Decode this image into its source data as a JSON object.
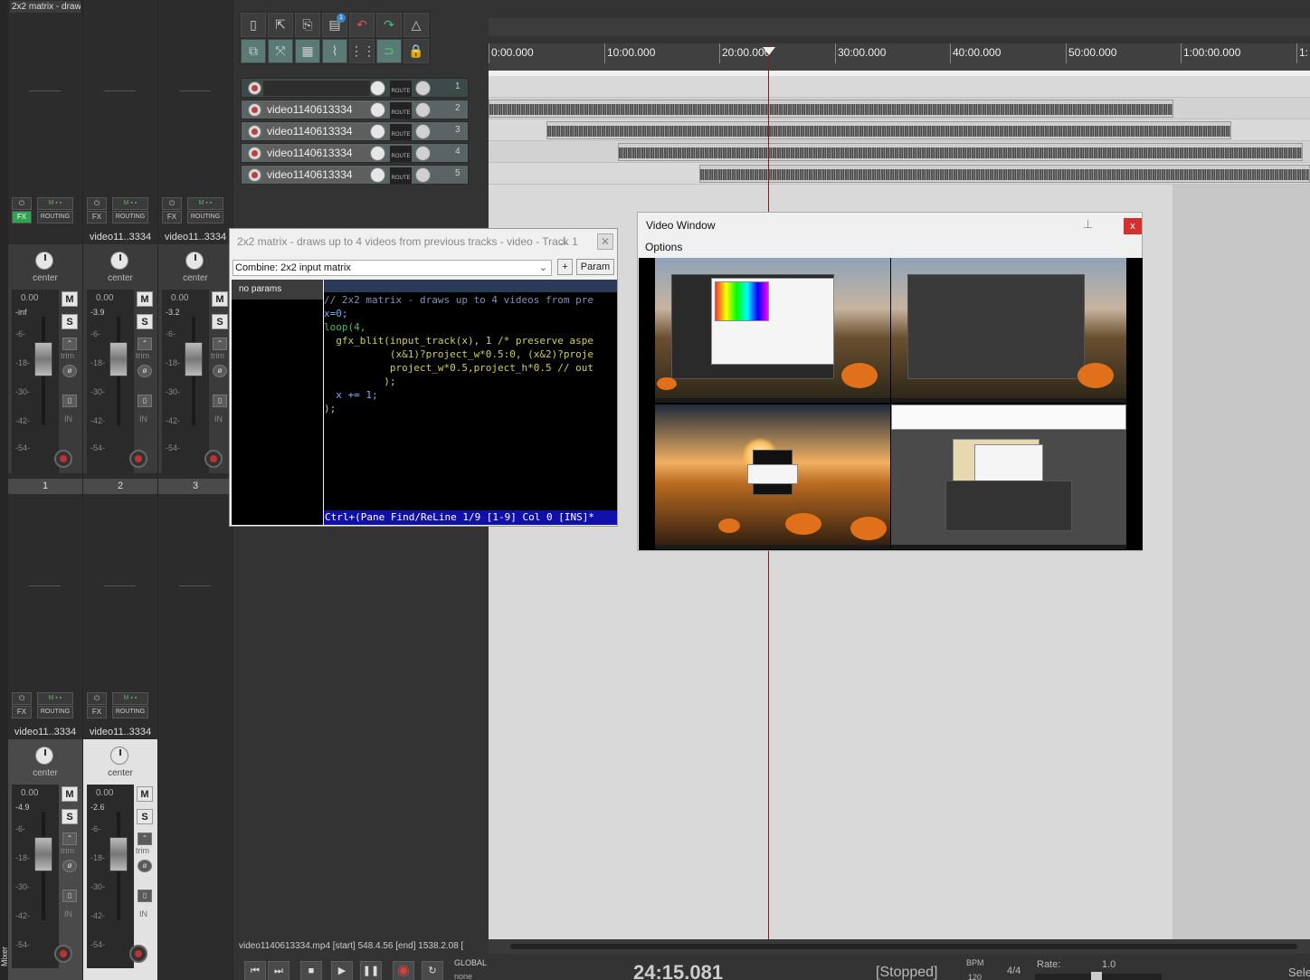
{
  "mixer": {
    "title": "2x2 matrix - draw",
    "side_label": "Mixer",
    "strips_top": [
      {
        "name": "",
        "number": "1",
        "volume": "0.00",
        "peak": "-inf",
        "pan": "center",
        "fx": "FX",
        "routing": "ROUTING",
        "fx_active": true
      },
      {
        "name": "video11..3334",
        "number": "2",
        "volume": "0.00",
        "peak": "-3.9",
        "pan": "center",
        "fx": "FX",
        "routing": "ROUTING",
        "fx_active": false
      },
      {
        "name": "video11..3334",
        "number": "3",
        "volume": "0.00",
        "peak": "-3.2",
        "pan": "center",
        "fx": "FX",
        "routing": "ROUTING",
        "fx_active": false
      }
    ],
    "strips_bottom": [
      {
        "name": "video11..3334",
        "volume": "0.00",
        "peak": "-4.9",
        "pan": "center",
        "fx": "FX",
        "routing": "ROUTING"
      },
      {
        "name": "video11..3334",
        "volume": "0.00",
        "peak": "-2.6",
        "pan": "center",
        "fx": "FX",
        "routing": "ROUTING"
      }
    ],
    "scale": [
      "-6-",
      "-18-",
      "-30-",
      "-42-",
      "-54-"
    ],
    "scale_full": [
      "-6-",
      "-18-",
      "-30-",
      "-42-",
      "-54-"
    ],
    "mute_label": "M",
    "solo_label": "S",
    "trim_label": "trim",
    "in_label": "IN"
  },
  "tracks": [
    {
      "number": "1",
      "name": "",
      "route": "ROUTE",
      "selected": true
    },
    {
      "number": "2",
      "name": "video1140613334",
      "route": "ROUTE"
    },
    {
      "number": "3",
      "name": "video1140613334",
      "route": "ROUTE"
    },
    {
      "number": "4",
      "name": "video1140613334",
      "route": "ROUTE"
    },
    {
      "number": "5",
      "name": "video1140613334",
      "route": "ROUTE"
    }
  ],
  "toolbar": {
    "badge": "1",
    "icons": [
      "new-project-icon",
      "open-project-icon",
      "save-project-icon",
      "project-settings-icon",
      "undo-icon",
      "redo-icon",
      "metronome-icon",
      "auto-crossfade-icon",
      "ripple-edit-icon",
      "item-grouping-icon",
      "envelope-points-icon",
      "grid-icon",
      "snap-icon",
      "lock-icon"
    ]
  },
  "ruler": {
    "labels": [
      "0:00.000",
      "10:00.000",
      "20:00.000",
      "30:00.000",
      "40:00.000",
      "50:00.000",
      "1:00:00.000",
      "1:"
    ]
  },
  "fx_window": {
    "title": "2x2 matrix - draws up to 4 videos from previous tracks - video - Track 1",
    "combine": "Combine: 2x2 input matrix",
    "plus": "+",
    "param": "Param",
    "no_params": "no params",
    "code": {
      "l1": "// 2x2 matrix - draws up to 4 videos from pre",
      "l2a": "x=0;",
      "l3a": "loop(4,",
      "l4a": "  gfx_blit(input_track(x), 1 /* preserve aspe",
      "l5a": "           (x&1)?project_w*0.5:0, (x&2)?proje",
      "l6a": "           project_w*0.5,project_h*0.5 // out",
      "l7a": "          );",
      "l8a": "  x += 1;",
      "l9a": ");"
    },
    "status": "Ctrl+(Pane Find/ReLine 1/9 [1-9] Col 0 [INS]*"
  },
  "video_window": {
    "title": "Video Window",
    "options": "Options",
    "close": "x"
  },
  "bottom": {
    "status": "video1140613334.mp4 [start] 548.4.56 [end] 1538.2.08 [",
    "timecode": "24:15.081",
    "state": "[Stopped]",
    "bpm_label": "BPM",
    "bpm_value": "120",
    "signature": "4/4",
    "rate_label": "Rate:",
    "rate_value": "1.0",
    "global": "GLOBAL",
    "global_value": "none",
    "sele": "Sele"
  }
}
